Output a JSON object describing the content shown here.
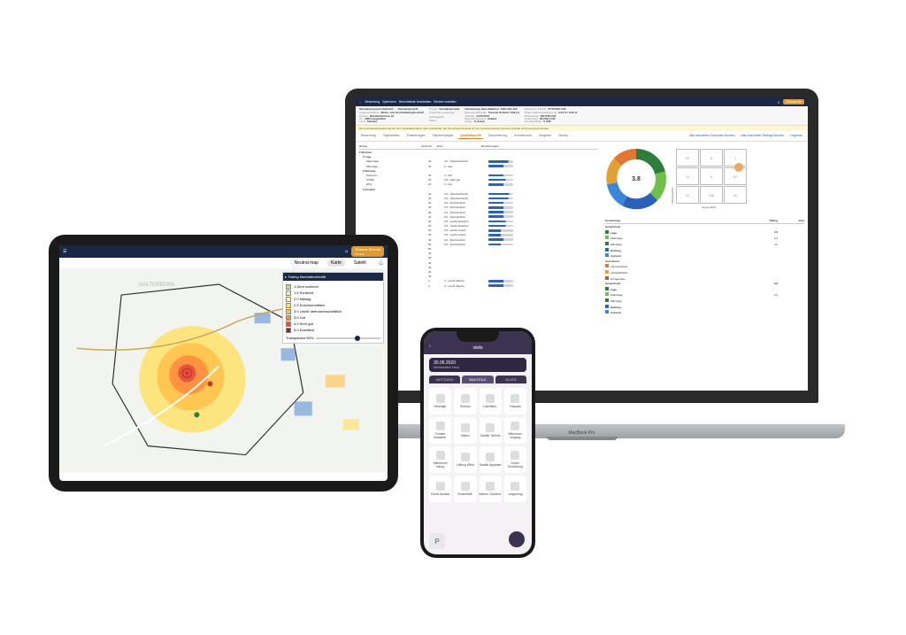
{
  "laptop": {
    "badge": "MacBook Pro",
    "topbar": {
      "back": "←",
      "title": "Bewertung",
      "save": "Speichern",
      "edit": "Berichtsliste bearbeiten",
      "create": "Bericht erstellen",
      "user": "Thomas Sc"
    },
    "header": {
      "project": {
        "title": "Überbauung beim Bahnhof",
        "subtitle": "Standardprojekt",
        "rows": [
          [
            "Liegenschaftstyp",
            "Wohn- und Geschäftsliegenschaft"
          ],
          [
            "Strasse",
            "Bahnhofstrasse 16"
          ],
          [
            "Ort",
            "4900 Langenthal"
          ],
          [
            "Land",
            "Schweiz"
          ]
        ],
        "rows2": [
          [
            "Projekt",
            "Standardprojekt"
          ],
          [
            "Projekt-Bemerkungen",
            ""
          ],
          [
            "Auftraggeber",
            ""
          ],
          [
            "Status",
            ""
          ]
        ]
      },
      "valuation": {
        "title": "Überbauung beim Bahnhof",
        "id": "1394-461-100",
        "rows": [
          [
            "Bewerter/Methode",
            "Thomas Schmid / EW (s)"
          ],
          [
            "Stichtag",
            "10.05.2021"
          ],
          [
            "Bewertungsgrund",
            "Ankauf"
          ],
          [
            "Status",
            "In Arbeit"
          ]
        ]
      },
      "value": {
        "title": "Marktwert ★★★★",
        "amount": "8'770'000 CHF",
        "rows": [
          [
            "Brutto-/Nettokapitalisierung",
            "3.44 % / 3.00 %"
          ],
          [
            "Bruttoertrag",
            "361'008 CHF"
          ],
          [
            "Nettoertrag",
            "301'994 CHF"
          ],
          [
            "Zu-/Abschläge",
            "0 CHF"
          ]
        ]
      }
    },
    "warning": "Die Grundstücksbewertung auf dem Qualitätsprofil ist nicht vollständig. Die Musterberichtsstufe für die Investitionskosten können deshalb nicht berechnet werden.",
    "tabs": [
      "Bewertung",
      "Objektdaten",
      "Einstellungen",
      "Flächenspiegel",
      "Qualitätsprofil",
      "Diskontierung",
      "Investitionen",
      "Vergleich",
      "Bericht"
    ],
    "tabActive": 4,
    "tabActions": [
      "Alle manuellen Gewichte löschen",
      "Alle manuellen Ratings löschen",
      "Legende"
    ],
    "ratingHead": [
      "Rating",
      "Gewicht",
      "Note",
      "Bemerkungen"
    ],
    "ratings": [
      {
        "lvl": 0,
        "name": "Wohnen",
        "g": "",
        "note": "",
        "p": 0
      },
      {
        "lvl": 1,
        "name": "Lage",
        "g": "",
        "note": "",
        "p": 0
      },
      {
        "lvl": 2,
        "name": "Makrolage",
        "g": "40",
        "note": "4.0 - Überdurchschn.",
        "p": 80
      },
      {
        "lvl": 2,
        "name": "Mikrolage",
        "g": "40",
        "note": "3 - Gut",
        "p": 60
      },
      {
        "lvl": 1,
        "name": "Nutzung",
        "g": "",
        "note": "",
        "p": 0
      },
      {
        "lvl": 2,
        "name": "Wohnmix",
        "g": "40",
        "note": "3 - Gut",
        "p": 60
      },
      {
        "lvl": 2,
        "name": "STWE",
        "g": "20",
        "note": "3.5 - Sehr gut",
        "p": 70
      },
      {
        "lvl": 2,
        "name": "DFN",
        "g": "20",
        "note": "3 - Gut",
        "p": 60
      },
      {
        "lvl": 1,
        "name": "Zustand",
        "g": "",
        "note": "",
        "p": 0
      },
      {
        "lvl": 2,
        "name": "",
        "g": "40",
        "note": "4.2 - Überdurchschn.",
        "p": 84
      },
      {
        "lvl": 2,
        "name": "",
        "g": "40",
        "note": "4.0 - Überdurchschn.",
        "p": 80
      },
      {
        "lvl": 2,
        "name": "",
        "g": "20",
        "note": "3.0 - Durchschnitt",
        "p": 60
      },
      {
        "lvl": 2,
        "name": "",
        "g": "40",
        "note": "3.0 - Durchschnitt",
        "p": 60
      },
      {
        "lvl": 2,
        "name": "",
        "g": "40",
        "note": "3.0 - Durchschnitt",
        "p": 60
      },
      {
        "lvl": 2,
        "name": "",
        "g": "40",
        "note": "3.0 - Durchschnitt",
        "p": 60
      },
      {
        "lvl": 2,
        "name": "",
        "g": "20",
        "note": "3.5 - Leicht überdurc.",
        "p": 70
      },
      {
        "lvl": 2,
        "name": "",
        "g": "20",
        "note": "3.5 - Leicht überdurc.",
        "p": 70
      },
      {
        "lvl": 2,
        "name": "",
        "g": "20",
        "note": "2.5 - Leicht unterd.",
        "p": 50
      },
      {
        "lvl": 2,
        "name": "",
        "g": "20",
        "note": "2.5 - Leicht unterd.",
        "p": 50
      },
      {
        "lvl": 2,
        "name": "",
        "g": "40",
        "note": "3.0 - Durchschnitt",
        "p": 60
      },
      {
        "lvl": 2,
        "name": "",
        "g": "50",
        "note": "2.5 - Durchschnitt",
        "p": 50
      },
      {
        "lvl": 2,
        "name": "",
        "g": "50",
        "note": "",
        "p": 0
      },
      {
        "lvl": 2,
        "name": "",
        "g": "40",
        "note": "",
        "p": 0
      },
      {
        "lvl": 2,
        "name": "",
        "g": "40",
        "note": "",
        "p": 0
      },
      {
        "lvl": 2,
        "name": "",
        "g": "40",
        "note": "",
        "p": 0
      },
      {
        "lvl": 2,
        "name": "",
        "g": "40",
        "note": "",
        "p": 0
      },
      {
        "lvl": 2,
        "name": "",
        "g": "40",
        "note": "",
        "p": 0
      },
      {
        "lvl": 2,
        "name": "",
        "g": "40",
        "note": "",
        "p": 0
      },
      {
        "lvl": 2,
        "name": "",
        "g": "3",
        "note": "3 - Leicht überdu.",
        "p": 60
      },
      {
        "lvl": 2,
        "name": "",
        "g": "3",
        "note": "3 - Leicht überdu.",
        "p": 60
      }
    ],
    "donutCenter": "3.8",
    "matrixAxisY": "Objektqualität",
    "matrixAxisX": "Lagequalität",
    "matrixLabels": [
      "III",
      "II",
      "I",
      "VI",
      "V",
      "IV",
      "IX",
      "VIII",
      "VII"
    ],
    "summaryHead": [
      "Gesamtnote",
      "Rating",
      "Gew"
    ],
    "summary": [
      {
        "name": "Gesamtnote",
        "val": "",
        "bold": true
      },
      {
        "name": "Lage",
        "val": "4.0",
        "c": "#2f7d3c",
        "bold": true
      },
      {
        "name": "Makrolage",
        "val": "4.0",
        "c": "#6fbf4a"
      },
      {
        "name": "Mikrolage",
        "val": "4.0",
        "c": "#2f7d3c"
      },
      {
        "name": "Nutzung",
        "val": "",
        "c": "#2a62b8",
        "bold": true
      },
      {
        "name": "Zustand",
        "val": "",
        "c": "#3b86d6",
        "bold": true
      },
      {
        "name": "Investment",
        "val": "",
        "bold": true
      },
      {
        "name": "Vermietbarkeit",
        "val": "",
        "c": "#e07834"
      },
      {
        "name": "Verkäuflichkeit",
        "val": "",
        "c": "#e0a034"
      },
      {
        "name": "Ertragsrisiko",
        "val": "",
        "c": "#b85c2c"
      },
      {
        "name": "Gesamtnote",
        "val": "3.8",
        "bold": true
      },
      {
        "name": "Lage",
        "val": "",
        "c": "#2f7d3c",
        "bold": true
      },
      {
        "name": "Makrolage",
        "val": "4.0",
        "c": "#6fbf4a"
      },
      {
        "name": "Mikrolage",
        "val": "",
        "c": "#2f7d3c"
      },
      {
        "name": "Nutzung",
        "val": "",
        "c": "#2a62b8",
        "bold": true
      },
      {
        "name": "Zustand",
        "val": "",
        "c": "#3b86d6",
        "bold": true
      }
    ]
  },
  "tablet": {
    "user": "Thomas Schmid",
    "sub": "FP Test",
    "controls": [
      "Neutral map",
      "Karte",
      "Satelit"
    ],
    "controlActive": 1,
    "legend": {
      "title": "Rating Marktattraktivität",
      "items": [
        {
          "c": "#b9d6a0",
          "t": "1-Sehr schlecht"
        },
        {
          "c": "#e8f0be",
          "t": "1.5 Schlecht"
        },
        {
          "c": "#fff3a6",
          "t": "2.0 Mässig"
        },
        {
          "c": "#ffe05a",
          "t": "2.5 Durchschnittlich"
        },
        {
          "c": "#ffbf47",
          "t": "3.0 Leicht überdurchschnittlich"
        },
        {
          "c": "#ff8a3c",
          "t": "3.5 Gut"
        },
        {
          "c": "#e74c3c",
          "t": "4.0 Sehr gut"
        },
        {
          "c": "#7b2d1f",
          "t": "5.0 Exzellent"
        }
      ],
      "trans": "Transparenz 60%"
    }
  },
  "phone": {
    "brand": "visits",
    "date": "30.06.2020",
    "dateSub": "Mehrfamilien Haus",
    "tabs": [
      "NUTZUNG",
      "BAUTEILE",
      "ALLES"
    ],
    "tabActive": 1,
    "tiles": [
      "Hinaufgel.",
      "Rohbau",
      "Dachfläch.",
      "Fassade",
      "Fenster Aussenth.",
      "Elektro",
      "Sanitär Technik",
      "Wärmever. sorgung",
      "Wärmevert eilung",
      "Lüftung Klima",
      "Sanitär Apparate",
      "Küche Einrichtung",
      "Küche Ausbau",
      "Bodenbelä.",
      "Wandv. Deckenv.",
      "Umgebung"
    ],
    "btm": "P"
  },
  "chart_data": {
    "type": "pie",
    "title": "Qualitätsprofil",
    "center_value": 3.8,
    "series": [
      {
        "name": "Makrolage",
        "value": 4.0,
        "color": "#6fbf4a"
      },
      {
        "name": "Mikrolage",
        "value": 4.0,
        "color": "#2f7d3c"
      },
      {
        "name": "Nutzung",
        "value": 3.5,
        "color": "#2a62b8"
      },
      {
        "name": "Zustand",
        "value": 3.5,
        "color": "#3b86d6"
      },
      {
        "name": "Vermietbarkeit",
        "value": 3.8,
        "color": "#e07834"
      },
      {
        "name": "Verkäuflichkeit",
        "value": 3.8,
        "color": "#e0a034"
      }
    ]
  }
}
